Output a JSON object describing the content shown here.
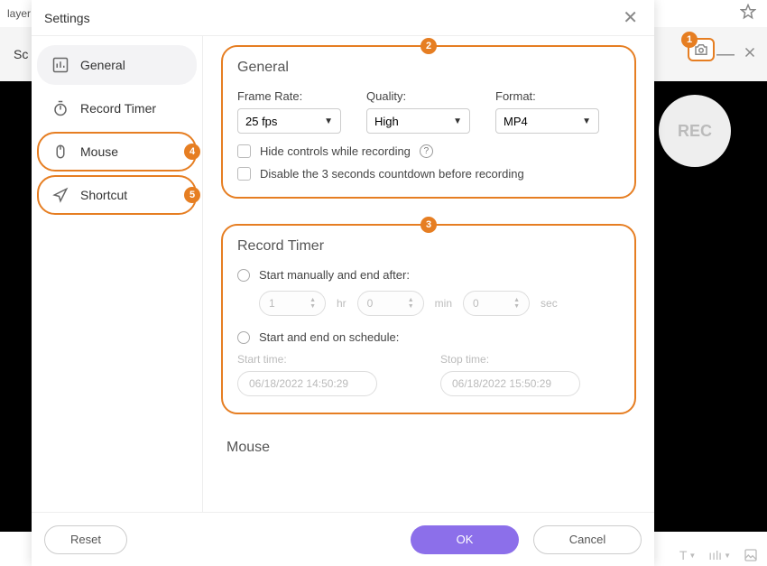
{
  "app": {
    "brand_fragment": "layer"
  },
  "dialog": {
    "title": "Settings",
    "nav": {
      "general": "General",
      "record_timer": "Record Timer",
      "mouse": "Mouse",
      "shortcut": "Shortcut"
    },
    "general_section": {
      "title": "General",
      "frame_rate_label": "Frame Rate:",
      "frame_rate_value": "25 fps",
      "quality_label": "Quality:",
      "quality_value": "High",
      "format_label": "Format:",
      "format_value": "MP4",
      "hide_controls": "Hide controls while recording",
      "disable_countdown": "Disable the 3 seconds countdown before recording"
    },
    "timer_section": {
      "title": "Record Timer",
      "mode_manual": "Start manually and end after:",
      "hr": "1",
      "hr_unit": "hr",
      "min": "0",
      "min_unit": "min",
      "sec": "0",
      "sec_unit": "sec",
      "mode_schedule": "Start and end on schedule:",
      "start_label": "Start time:",
      "start_value": "06/18/2022 14:50:29",
      "stop_label": "Stop time:",
      "stop_value": "06/18/2022 15:50:29"
    },
    "mouse_title": "Mouse",
    "footer": {
      "reset": "Reset",
      "ok": "OK",
      "cancel": "Cancel"
    }
  },
  "back": {
    "left_text": "Sc",
    "rec_label": "REC"
  },
  "annotations": {
    "a1": "1",
    "a2": "2",
    "a3": "3",
    "a4": "4",
    "a5": "5"
  }
}
